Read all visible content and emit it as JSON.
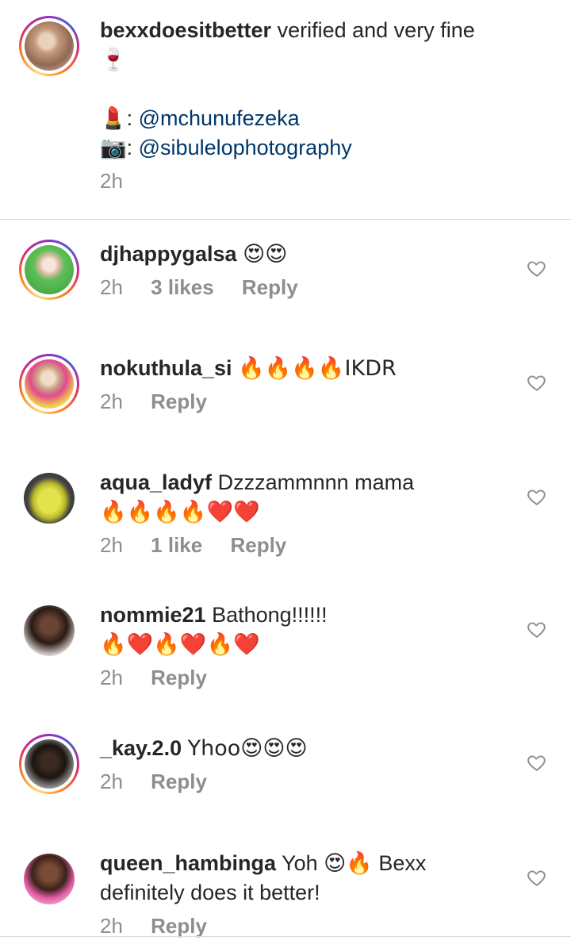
{
  "caption": {
    "username": "bexxdoesitbetter",
    "text": "verified and very fine",
    "line2_emoji": "🍷",
    "credit1_emoji": "💄",
    "credit1_mention": "@mchunufezeka",
    "credit2_emoji": "📷",
    "credit2_mention": "@sibulelophotography",
    "time": "2h"
  },
  "comments": [
    {
      "username": "djhappygalsa",
      "text": "😍😍",
      "time": "2h",
      "likes": "3 likes",
      "reply": "Reply"
    },
    {
      "username": "nokuthula_si",
      "text": "🔥🔥🔥🔥IKDR",
      "time": "2h",
      "reply": "Reply"
    },
    {
      "username": "aqua_ladyf",
      "text": "Dzzzammnnn mama",
      "text2": "🔥🔥🔥🔥❤️❤️",
      "time": "2h",
      "likes": "1 like",
      "reply": "Reply"
    },
    {
      "username": "nommie21",
      "text": "Bathong!!!!!!",
      "text2": "🔥❤️🔥❤️🔥❤️",
      "time": "2h",
      "reply": "Reply"
    },
    {
      "username": "_kay.2.0",
      "text": "Yhoo😍😍😍",
      "time": "2h",
      "reply": "Reply"
    },
    {
      "username": "queen_hambinga",
      "text": "Yoh 😍🔥 Bexx definitely does it better!",
      "time": "2h",
      "reply": "Reply"
    }
  ],
  "icons": {
    "like": "heart-outline-icon"
  }
}
